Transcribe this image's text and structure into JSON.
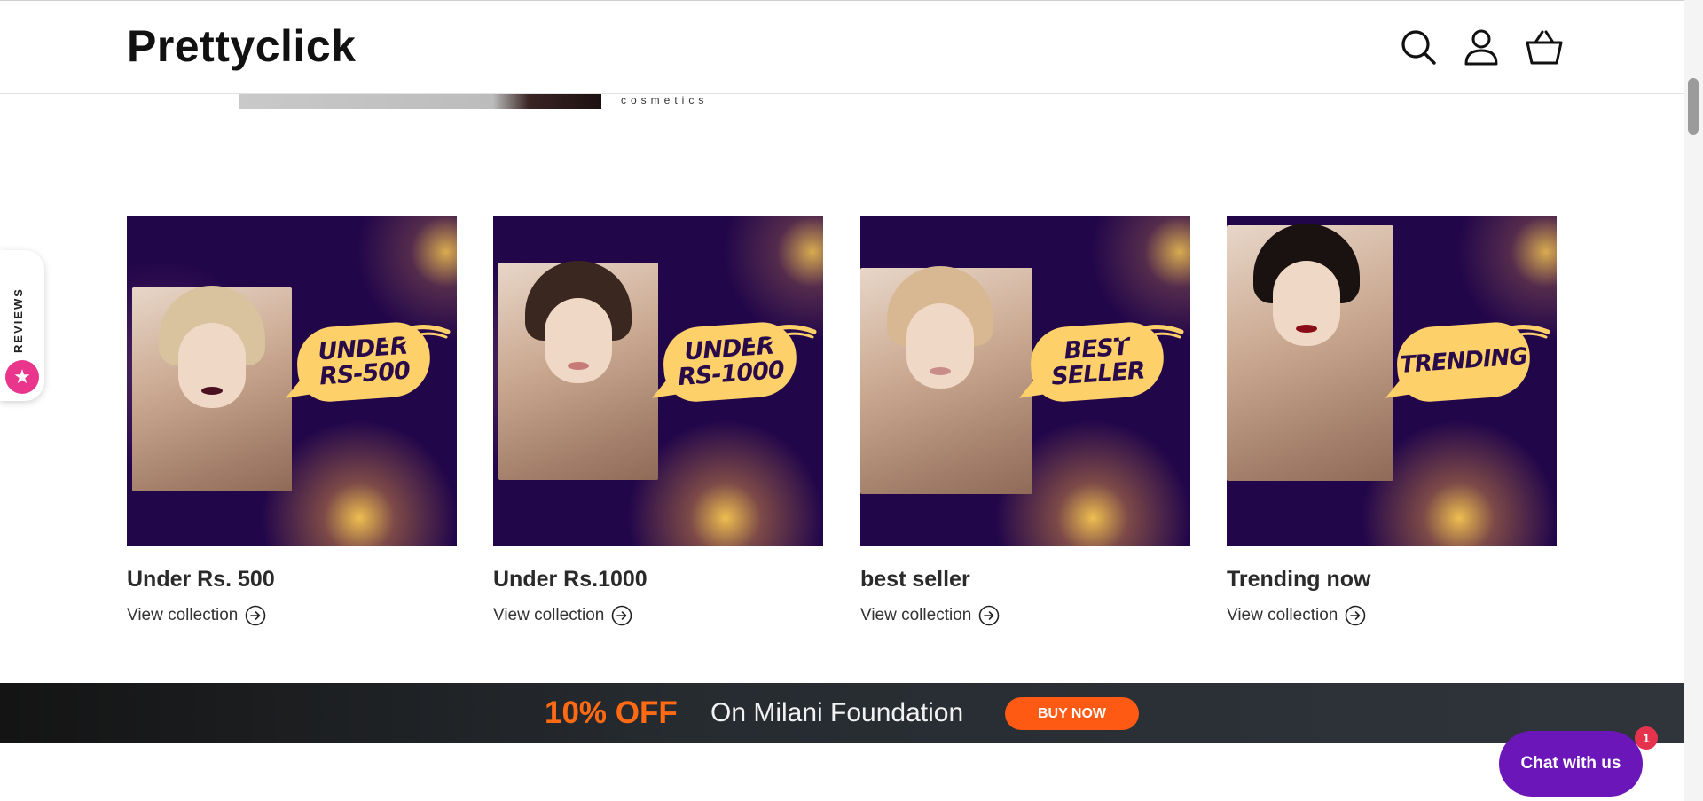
{
  "header": {
    "logo": "Prettyclick",
    "icons": [
      "search-icon",
      "account-icon",
      "cart-icon"
    ]
  },
  "banner_peek": {
    "text": "cosmetics"
  },
  "reviews_tab": {
    "label": "REVIEWS",
    "icon": "star-icon"
  },
  "collections": [
    {
      "title": "Under Rs. 500",
      "link": "View collection",
      "badge_line1": "UNDER",
      "badge_line2": "RS-500",
      "hair": "#d9c39e",
      "lips": "#4a1020"
    },
    {
      "title": "Under Rs.1000",
      "link": "View collection",
      "badge_line1": "UNDER",
      "badge_line2": "RS-1000",
      "hair": "#3a2820",
      "lips": "#c77b78"
    },
    {
      "title": "best seller",
      "link": "View collection",
      "badge_line1": "BEST",
      "badge_line2": "SELLER",
      "hair": "#d8b892",
      "lips": "#c98c88"
    },
    {
      "title": "Trending now",
      "link": "View collection",
      "badge_line1": "TRENDING",
      "badge_line2": "",
      "hair": "#1a1210",
      "lips": "#8a0c16"
    }
  ],
  "promo": {
    "discount": "10% OFF",
    "text": "On Milani Foundation",
    "button": "BUY NOW"
  },
  "chat": {
    "label": "Chat with us",
    "badge": "1"
  },
  "colors": {
    "card_bg": "#22064a",
    "badge": "#fdd06a",
    "promo_accent": "#ff6a13",
    "chat": "#6b16b8"
  }
}
